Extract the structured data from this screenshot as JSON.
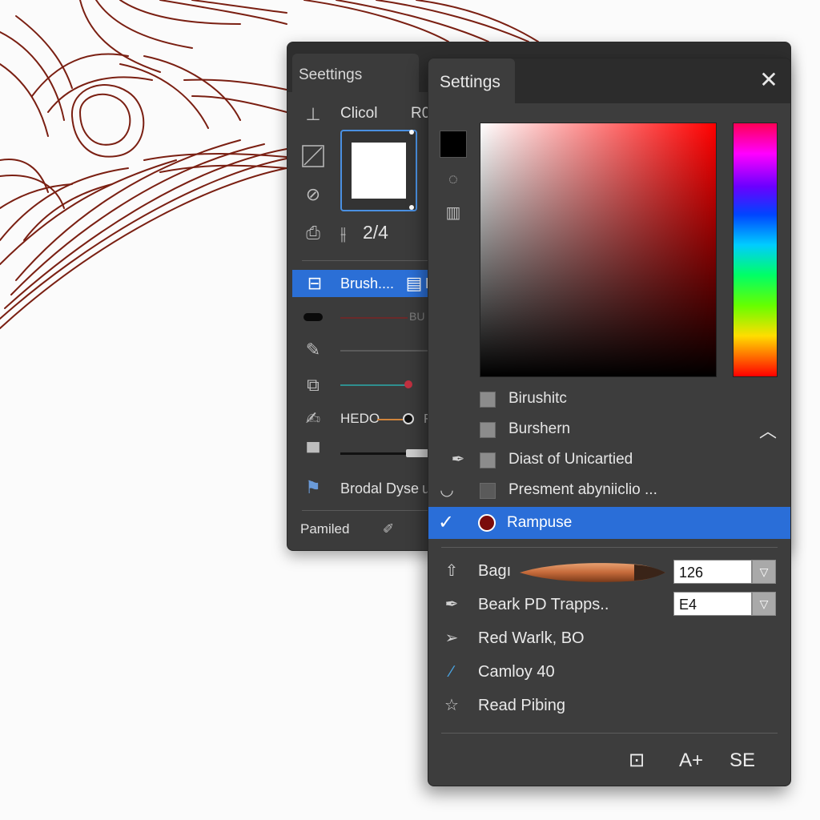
{
  "back_panel": {
    "tab_title": "Seettings",
    "color_label": "Clicol",
    "color_label_suffix": "R0",
    "page_indicator": "2/4",
    "selected_item": "Brush....",
    "selected_item_suffix": "B",
    "row_line1_label": "BU",
    "row_label_hedo": "HEDO",
    "row_label_hedo_suffix": "F",
    "row_label_brodal": "Brodal Dyse",
    "row_label_brodal_suffix": "u",
    "footer_label": "Pamiled",
    "footer_icon": "brush-pencil-icon"
  },
  "front_panel": {
    "tab_title": "Settings",
    "close_glyph": "✕",
    "foreground_color": "#000000",
    "picker": {
      "base_hue": "#ff0000"
    },
    "list_items": [
      {
        "label": "Birushitc",
        "checked": false
      },
      {
        "label": "Burshern",
        "checked": false
      },
      {
        "label": "Diast of Unicartied",
        "checked": false
      },
      {
        "label": "Presment abyniiclio ...",
        "checked": false
      }
    ],
    "selected_item": {
      "label": "Rampuse",
      "swatch_color": "#7a0c0c",
      "tick": "✓"
    },
    "properties": [
      {
        "label": "Bagı",
        "icon": "arrow-up-outline-icon",
        "field_value": "126"
      },
      {
        "label": "Beark PD Trapps..",
        "icon": "pen-nib-icon",
        "field_value": "E4"
      },
      {
        "label": "Red Warlk, BO",
        "icon": "paper-plane-icon"
      },
      {
        "label": "Camloy 40",
        "icon": "blue-pen-icon"
      },
      {
        "label": "Read Pibing",
        "icon": "star-outline-icon"
      }
    ],
    "footer": {
      "btn_panel": "⊡",
      "btn_font_size": "A+",
      "btn_se": "SE"
    }
  },
  "colors": {
    "accent": "#2a6ed8",
    "panel_bg": "#3d3d3d",
    "sketch_stroke": "#7a1f12"
  }
}
